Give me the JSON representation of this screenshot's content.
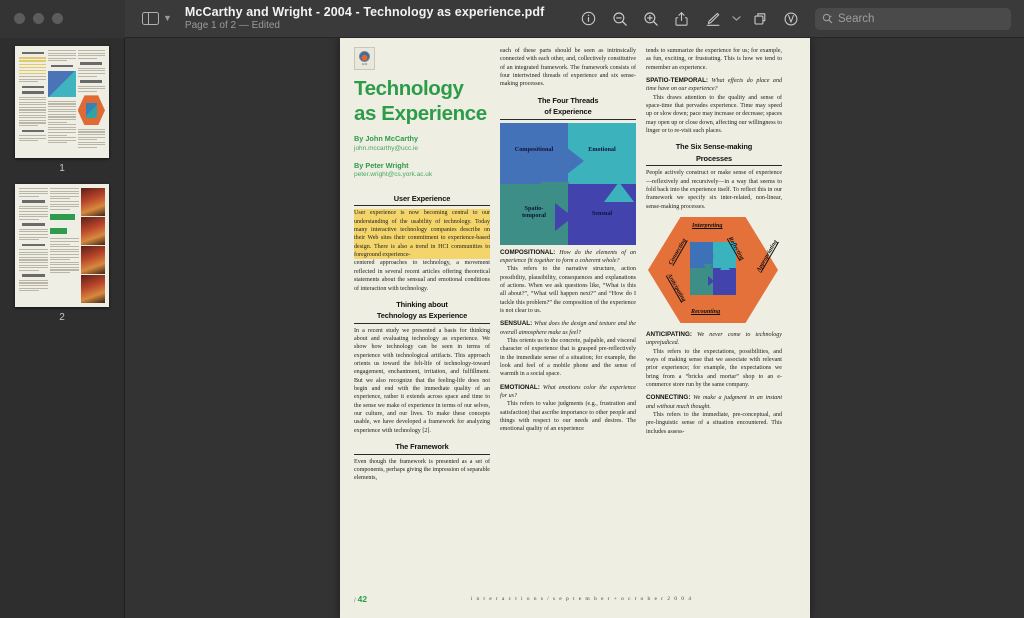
{
  "window": {
    "app": "Preview",
    "traffic_lights": [
      "close",
      "minimize",
      "zoom"
    ]
  },
  "toolbar": {
    "sidebar_toggle_label": "Sidebar",
    "doc_title": "McCarthy and Wright - 2004 - Technology as experience.pdf",
    "doc_subtitle": "Page 1 of 2 — Edited",
    "buttons": [
      {
        "name": "info-icon",
        "label": "Info"
      },
      {
        "name": "zoom-out-icon",
        "label": "Zoom Out"
      },
      {
        "name": "zoom-in-icon",
        "label": "Zoom In"
      },
      {
        "name": "share-icon",
        "label": "Share"
      },
      {
        "name": "markup-icon",
        "label": "Markup"
      },
      {
        "name": "chevron-down-icon",
        "label": "Highlight Options"
      },
      {
        "name": "rotate-icon",
        "label": "Rotate"
      },
      {
        "name": "annotate-icon",
        "label": "Annotate"
      }
    ],
    "search_placeholder": "Search"
  },
  "sidebar": {
    "thumbnails": [
      {
        "label": "1",
        "selected": true
      },
      {
        "label": "2",
        "selected": false
      }
    ]
  },
  "document": {
    "title_line1": "Technology",
    "title_line2": "as Experience",
    "authors": [
      {
        "name": "By John McCarthy",
        "email": "john.mccarthy@ucc.ie"
      },
      {
        "name": "By Peter Wright",
        "email": "peter.wright@cs.york.ac.uk"
      }
    ],
    "col1": {
      "head_user_experience": "User Experience",
      "highlighted_para": "User experience is now becoming central to our understanding of the usability of technology. Today many interactive technology companies describe on their Web sites their commitment to experience-based design. There is also a trend in HCI communities to foreground experience-",
      "para_rest": "centered approaches to technology, a movement reflected in several recent articles offering theoretical statements about the sensual and emotional conditions of interaction with technology.",
      "head_thinking_1": "Thinking about",
      "head_thinking_2": "Technology as Experience",
      "para_thinking": "In a recent study we presented a basis for thinking about and evaluating technology as experience. We show how technology can be seen in terms of experience with technological artifacts. This approach orients us toward the felt-life of technology-toward engagement, enchantment, irritation, and fulfillment. But we also recognize that the feeling-life does not begin and end with the immediate quality of an experience, rather it extends across space and time to the sense we make of experience in terms of our selves, our culture, and our lives. To make these concepts usable, we have developed a framework for analyzing experience with technology [2].",
      "head_framework": "The Framework",
      "para_framework": "Even though the framework is presented as a set of components, perhaps giving the impression of separable elements,"
    },
    "col2": {
      "para_top": "each of these parts should be seen as intrinsically connected with each other, and, collectively constitutive of an integrated framework. The framework consists of four intertwined threads of experience and six sense-making processes.",
      "head_threads_1": "The Four Threads",
      "head_threads_2": "of Experience",
      "figure_labels": {
        "compositional": "Compositional",
        "emotional": "Emotional",
        "spatio_temporal": "Spatio-\ntemporal",
        "sensual": "Sensual"
      },
      "compositional_term": "COMPOSITIONAL:",
      "compositional_q": " How do the elements of an experience fit together to form a coherent whole?",
      "compositional_body": "This refers to the narrative structure, action possibility, plausibility, consequences and explanations of actions. When we ask questions like, “What is this all about?”, “What will happen next?” and “How do I tackle this problem?” the composition of the experience is not clear to us.",
      "sensual_term": "SENSUAL:",
      "sensual_q": " What does the design and texture and the overall atmosphere make us feel?",
      "sensual_body": "This orients us to the concrete, palpable, and visceral character of experience that is grasped pre-reflectively in the immediate sense of a situation; for example, the look and feel of a mobile phone and the sense of warmth in a social space.",
      "emotional_term": "EMOTIONAL:",
      "emotional_q": " What emotions color the experience for us?",
      "emotional_body": "This refers to value judgments (e.g., frustration and satisfaction) that ascribe importance to other people and things with respect to our needs and desires. The emotional quality of an experience"
    },
    "col3": {
      "para_top": "tends to summarize the experience for us; for example, as fun, exciting, or frustrating. This is how we tend to remember an experience.",
      "spatio_term": "SPATIO-TEMPORAL:",
      "spatio_q": " What effects do place and time have on our experience?",
      "spatio_body": "This draws attention to the quality and sense of space-time that pervades experience. Time may speed up or slow down; pace may increase or decrease; spaces may open up or close down, affecting our willingness to linger or to re-visit such places.",
      "head_six_1": "The Six Sense-making",
      "head_six_2": "Processes",
      "para_six": "People actively construct or make sense of experience—reflexively and recursively—in a way that seems to fold back into the experience itself. To reflect this in our framework we specify six inter-related, non-linear, sense-making processes.",
      "hex_labels": {
        "interpreting": "Interpreting",
        "reflecting": "Reflecting",
        "appropriating": "Appropriating",
        "recounting": "Recounting",
        "anticipating": "Anticipating",
        "connecting": "Connecting"
      },
      "anticipating_term": "ANTICIPATING:",
      "anticipating_q": " We never come to technology unprejudiced.",
      "anticipating_body": "This refers to the expectations, possibilities, and ways of making sense that we associate with relevant prior experience; for example, the expectations we bring from a “bricks and mortar” shop to an e-commerce store run by the same company.",
      "connecting_term": "CONNECTING:",
      "connecting_q": " We make a judgment in an instant and without much thought.",
      "connecting_body": "This refers to the immediate, pre-conceptual, and pre-linguistic sense of a situation encountered. This includes assess-"
    },
    "footer": {
      "page_prefix": "/",
      "page_number": "42",
      "center": "i n t e r a c t i o n s   /   s e p t e m b e r  +  o c t o b e r   2 0 0 4"
    }
  },
  "colors": {
    "title_green": "#2d9c4a",
    "highlight_yellow": "#f4d56b",
    "hex_orange": "#e4703a",
    "quad_blue": "#4472b8",
    "quad_teal": "#3cb2bd",
    "quad_green": "#3d8e86",
    "quad_indigo": "#4343ad",
    "page_bg": "#efeee2",
    "chrome_bg": "#3a3a3a"
  }
}
